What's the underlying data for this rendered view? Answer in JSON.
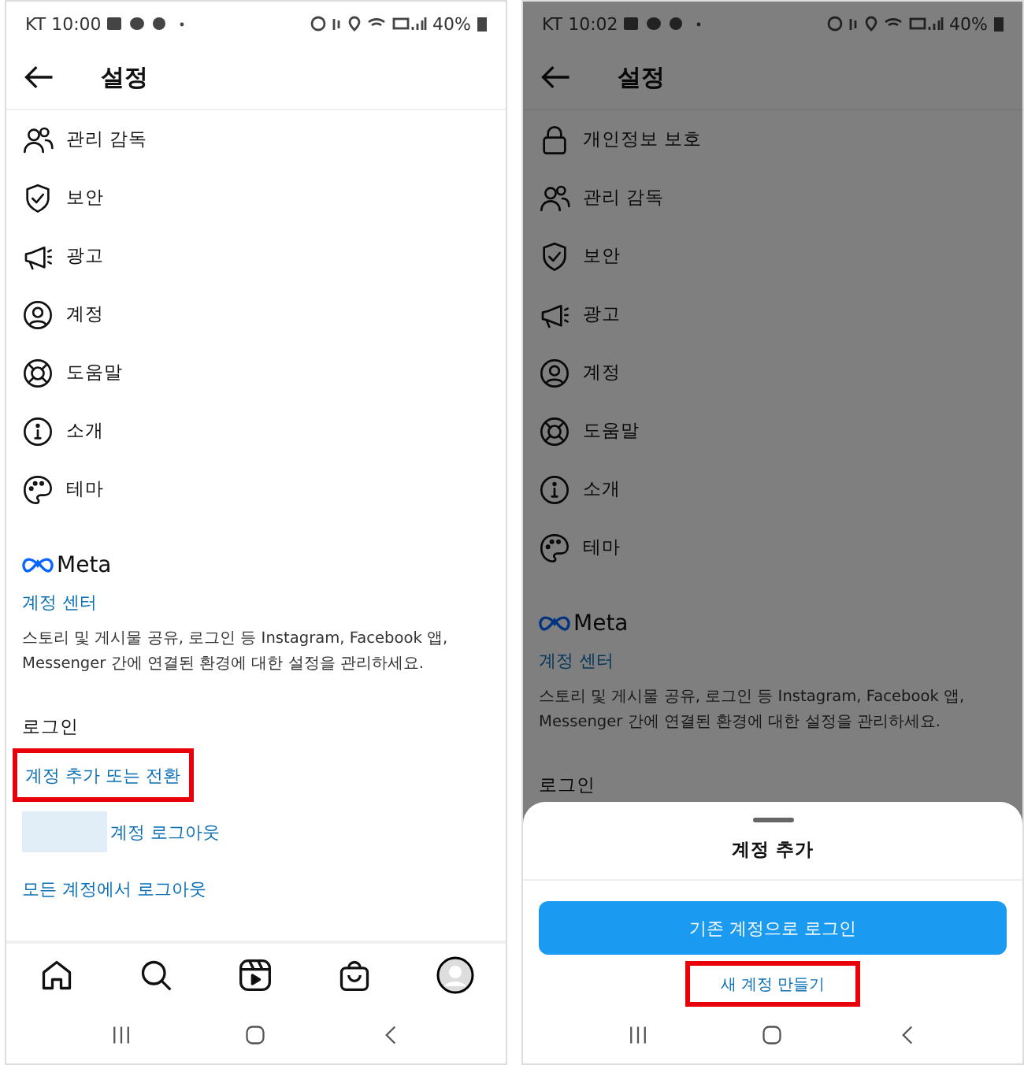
{
  "screens": [
    {
      "status_bar": {
        "time": "KT 10:00",
        "battery": "40%"
      },
      "title": "설정",
      "dimmed": false,
      "menu": [
        {
          "kind": "people",
          "label": "관리 감독"
        },
        {
          "kind": "shield",
          "label": "보안"
        },
        {
          "kind": "megaphone",
          "label": "광고"
        },
        {
          "kind": "account",
          "label": "계정"
        },
        {
          "kind": "lifebuoy",
          "label": "도움말"
        },
        {
          "kind": "info",
          "label": "소개"
        },
        {
          "kind": "palette",
          "label": "테마"
        }
      ],
      "meta": {
        "brand": "Meta",
        "link": "계정 센터",
        "description": "스토리 및 게시물 공유, 로그인 등 Instagram, Facebook 앱, Messenger 간에 연결된 환경에 대한 설정을 관리하세요."
      },
      "login": {
        "heading": "로그인",
        "options": [
          {
            "kind": "link",
            "label": "계정 추가 또는 전환",
            "highlighted": true
          },
          {
            "kind": "redacted",
            "label": "계정 로그아웃",
            "highlighted": false
          },
          {
            "kind": "link",
            "label": "모든 계정에서 로그아웃",
            "highlighted": false
          }
        ]
      },
      "tab_bar": [
        {
          "kind": "home"
        },
        {
          "kind": "search"
        },
        {
          "kind": "reels"
        },
        {
          "kind": "shop"
        },
        {
          "kind": "avatar"
        }
      ]
    },
    {
      "status_bar": {
        "time": "KT 10:02",
        "battery": "40%"
      },
      "title": "설정",
      "dimmed": true,
      "menu": [
        {
          "kind": "lock",
          "label": "개인정보 보호"
        },
        {
          "kind": "people",
          "label": "관리 감독"
        },
        {
          "kind": "shield",
          "label": "보안"
        },
        {
          "kind": "megaphone",
          "label": "광고"
        },
        {
          "kind": "account",
          "label": "계정"
        },
        {
          "kind": "lifebuoy",
          "label": "도움말"
        },
        {
          "kind": "info",
          "label": "소개"
        },
        {
          "kind": "palette",
          "label": "테마"
        }
      ],
      "meta": {
        "brand": "Meta",
        "link": "계정 센터",
        "description": "스토리 및 게시물 공유, 로그인 등 Instagram, Facebook 앱, Messenger 간에 연결된 환경에 대한 설정을 관리하세요."
      },
      "login": {
        "heading": "로그인"
      },
      "sheet": {
        "title": "계정 추가",
        "primary": "기존 계정으로 로그인",
        "secondary": {
          "label": "새 계정 만들기",
          "highlighted": true
        }
      }
    }
  ]
}
